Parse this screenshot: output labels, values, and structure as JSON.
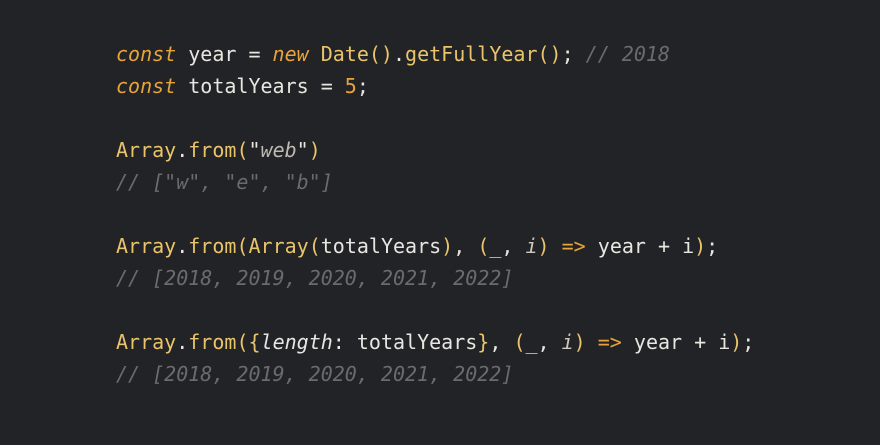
{
  "code": {
    "lines": [
      {
        "tokens": [
          {
            "cls": "kw",
            "text": "const"
          },
          {
            "cls": "ident",
            "text": " year = "
          },
          {
            "cls": "kw",
            "text": "new"
          },
          {
            "cls": "ident",
            "text": " "
          },
          {
            "cls": "cls",
            "text": "Date"
          },
          {
            "cls": "paren",
            "text": "()"
          },
          {
            "cls": "punc",
            "text": "."
          },
          {
            "cls": "fn",
            "text": "getFullYear"
          },
          {
            "cls": "paren",
            "text": "()"
          },
          {
            "cls": "punc",
            "text": "; "
          },
          {
            "cls": "comment",
            "text": "// 2018"
          }
        ]
      },
      {
        "tokens": [
          {
            "cls": "kw",
            "text": "const"
          },
          {
            "cls": "ident",
            "text": " totalYears = "
          },
          {
            "cls": "num",
            "text": "5"
          },
          {
            "cls": "punc",
            "text": ";"
          }
        ]
      },
      {
        "blank": true
      },
      {
        "tokens": [
          {
            "cls": "cls",
            "text": "Array"
          },
          {
            "cls": "punc",
            "text": "."
          },
          {
            "cls": "fn",
            "text": "from"
          },
          {
            "cls": "paren",
            "text": "("
          },
          {
            "cls": "str",
            "text": "\""
          },
          {
            "cls": "stritalic",
            "text": "web"
          },
          {
            "cls": "str",
            "text": "\""
          },
          {
            "cls": "paren",
            "text": ")"
          }
        ]
      },
      {
        "tokens": [
          {
            "cls": "comment",
            "text": "// [\"w\", \"e\", \"b\"]"
          }
        ]
      },
      {
        "blank": true
      },
      {
        "tokens": [
          {
            "cls": "cls",
            "text": "Array"
          },
          {
            "cls": "punc",
            "text": "."
          },
          {
            "cls": "fn",
            "text": "from"
          },
          {
            "cls": "paren",
            "text": "("
          },
          {
            "cls": "cls",
            "text": "Array"
          },
          {
            "cls": "paren",
            "text": "("
          },
          {
            "cls": "ident",
            "text": "totalYears"
          },
          {
            "cls": "paren",
            "text": ")"
          },
          {
            "cls": "punc",
            "text": ", "
          },
          {
            "cls": "paren",
            "text": "("
          },
          {
            "cls": "param",
            "text": "_"
          },
          {
            "cls": "punc",
            "text": ", "
          },
          {
            "cls": "param",
            "text": "i"
          },
          {
            "cls": "paren",
            "text": ")"
          },
          {
            "cls": "ident",
            "text": " "
          },
          {
            "cls": "arrow",
            "text": "=>"
          },
          {
            "cls": "ident",
            "text": " year + i"
          },
          {
            "cls": "paren",
            "text": ")"
          },
          {
            "cls": "punc",
            "text": ";"
          }
        ]
      },
      {
        "tokens": [
          {
            "cls": "comment",
            "text": "// [2018, 2019, 2020, 2021, 2022]"
          }
        ]
      },
      {
        "blank": true
      },
      {
        "tokens": [
          {
            "cls": "cls",
            "text": "Array"
          },
          {
            "cls": "punc",
            "text": "."
          },
          {
            "cls": "fn",
            "text": "from"
          },
          {
            "cls": "paren",
            "text": "({"
          },
          {
            "cls": "prop",
            "text": "length"
          },
          {
            "cls": "punc",
            "text": ": "
          },
          {
            "cls": "ident",
            "text": "totalYears"
          },
          {
            "cls": "paren",
            "text": "}"
          },
          {
            "cls": "punc",
            "text": ", "
          },
          {
            "cls": "paren",
            "text": "("
          },
          {
            "cls": "param",
            "text": "_"
          },
          {
            "cls": "punc",
            "text": ", "
          },
          {
            "cls": "param",
            "text": "i"
          },
          {
            "cls": "paren",
            "text": ")"
          },
          {
            "cls": "ident",
            "text": " "
          },
          {
            "cls": "arrow",
            "text": "=>"
          },
          {
            "cls": "ident",
            "text": " year + i"
          },
          {
            "cls": "paren",
            "text": ")"
          },
          {
            "cls": "punc",
            "text": ";"
          }
        ]
      },
      {
        "tokens": [
          {
            "cls": "comment",
            "text": "// [2018, 2019, 2020, 2021, 2022]"
          }
        ]
      }
    ]
  },
  "colors": {
    "background": "#222326",
    "keyword": "#e9a33b",
    "function": "#e9c46a",
    "comment": "#6b6b6b",
    "text": "#e8e6e1"
  }
}
